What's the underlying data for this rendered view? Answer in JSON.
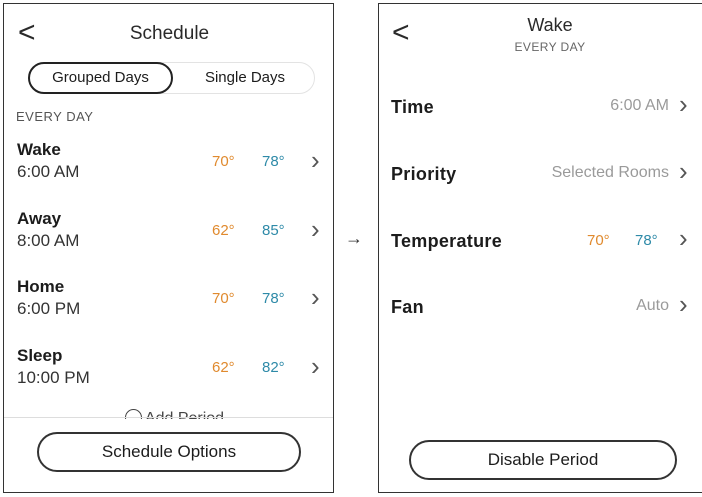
{
  "left_screen": {
    "title": "Schedule",
    "back_glyph": "<",
    "segmented": {
      "grouped_label": "Grouped Days",
      "single_label": "Single Days",
      "selected": "Grouped Days"
    },
    "section_label": "EVERY DAY",
    "periods": [
      {
        "name": "Wake",
        "time": "6:00 AM",
        "heat": "70°",
        "cool": "78°"
      },
      {
        "name": "Away",
        "time": "8:00 AM",
        "heat": "62°",
        "cool": "85°"
      },
      {
        "name": "Home",
        "time": "6:00 PM",
        "heat": "70°",
        "cool": "78°"
      },
      {
        "name": "Sleep",
        "time": "10:00 PM",
        "heat": "62°",
        "cool": "82°"
      }
    ],
    "add_period_label": "Add Period",
    "options_button": "Schedule Options"
  },
  "flow_arrow": "→",
  "right_screen": {
    "title": "Wake",
    "subtitle": "EVERY DAY",
    "back_glyph": "<",
    "settings": [
      {
        "label": "Time",
        "value": "6:00 AM"
      },
      {
        "label": "Priority",
        "value": "Selected Rooms"
      },
      {
        "label": "Temperature",
        "heat": "70°",
        "cool": "78°"
      },
      {
        "label": "Fan",
        "value": "Auto"
      }
    ],
    "disable_button": "Disable Period"
  },
  "colors": {
    "heat": "#e08a2e",
    "cool": "#2e8aa8",
    "muted_value": "#9a9a9a"
  },
  "icons": {
    "back": "chevron-left-icon",
    "row_nav": "chevron-right-icon",
    "add": "plus-circle-icon"
  }
}
